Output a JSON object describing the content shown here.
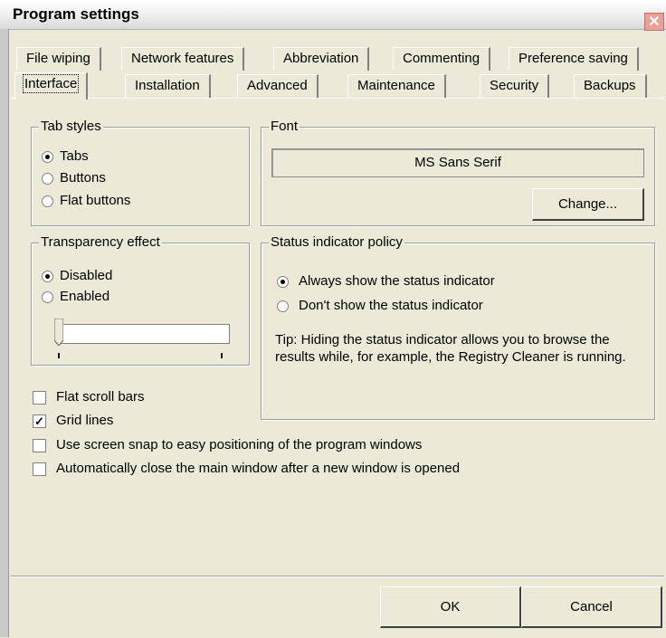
{
  "window": {
    "title": "Program settings",
    "close_glyph": "✕"
  },
  "tabs_row1": [
    {
      "label": "File wiping"
    },
    {
      "label": "Network features"
    },
    {
      "label": "Abbreviation"
    },
    {
      "label": "Commenting"
    },
    {
      "label": "Preference saving"
    }
  ],
  "tabs_row2": [
    {
      "label": "Interface",
      "active": true
    },
    {
      "label": "Installation"
    },
    {
      "label": "Advanced"
    },
    {
      "label": "Maintenance"
    },
    {
      "label": "Security"
    },
    {
      "label": "Backups"
    }
  ],
  "tab_styles": {
    "title": "Tab styles",
    "options": [
      {
        "label": "Tabs",
        "selected": true
      },
      {
        "label": "Buttons",
        "selected": false
      },
      {
        "label": "Flat buttons",
        "selected": false
      }
    ]
  },
  "font_group": {
    "title": "Font",
    "value": "MS Sans Serif",
    "change_label": "Change..."
  },
  "transparency": {
    "title": "Transparency effect",
    "options": [
      {
        "label": "Disabled",
        "selected": true
      },
      {
        "label": "Enabled",
        "selected": false
      }
    ],
    "slider_value": 0
  },
  "status_policy": {
    "title": "Status indicator policy",
    "options": [
      {
        "label": "Always show the status indicator",
        "selected": true
      },
      {
        "label": "Don't show the status indicator",
        "selected": false
      }
    ],
    "tip": "Tip: Hiding the status indicator allows you to browse the results while, for example, the Registry Cleaner is running."
  },
  "checkboxes": [
    {
      "label": "Flat scroll bars",
      "checked": false
    },
    {
      "label": "Grid lines",
      "checked": true
    },
    {
      "label": "Use screen snap to easy positioning of the program windows",
      "checked": false
    },
    {
      "label": "Automatically close the main window after a new window is opened",
      "checked": false
    }
  ],
  "buttons": {
    "ok": "OK",
    "cancel": "Cancel"
  }
}
